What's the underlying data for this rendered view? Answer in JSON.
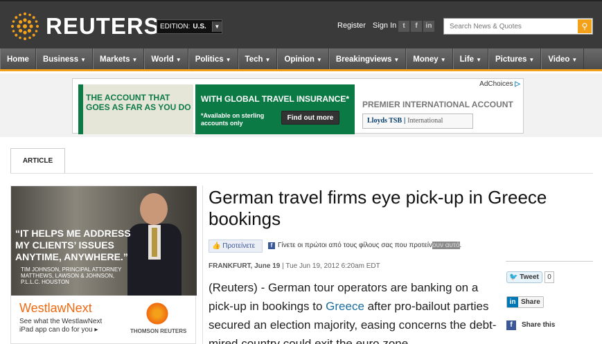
{
  "header": {
    "logo_text": "REUTERS",
    "edition_label": "EDITION:",
    "edition_value": "U.S.",
    "register": "Register",
    "signin": "Sign In",
    "search_placeholder": "Search News & Quotes",
    "accent_color": "#f4a11a"
  },
  "nav": {
    "items": [
      "Home",
      "Business",
      "Markets",
      "World",
      "Politics",
      "Tech",
      "Opinion",
      "Breakingviews",
      "Money",
      "Life",
      "Pictures",
      "Video"
    ]
  },
  "ad_banner": {
    "left_text": "THE ACCOUNT THAT GOES AS FAR AS YOU DO",
    "mid_heading": "WITH GLOBAL TRAVEL INSURANCE*",
    "mid_sub": "*Available on sterling accounts only",
    "mid_button": "Find out more",
    "right_heading": "PREMIER INTERNATIONAL ACCOUNT",
    "bank_name": "Lloyds TSB",
    "bank_sub": "International",
    "adchoices": "AdChoices"
  },
  "tab": {
    "label": "ARTICLE"
  },
  "side_ad": {
    "quote": "“IT HELPS ME ADDRESS MY CLIENTS’ ISSUES ANYTIME, ANYWHERE.”",
    "attribution": "TIM JOHNSON, PRINCIPAL ATTORNEY MATTHEWS, LAWSON & JOHNSON, P.L.L.C. HOUSTON",
    "brand": "WestlawNext",
    "sub": "See what the WestlawNext iPad app can do for you ▸",
    "tr_name": "THOMSON REUTERS"
  },
  "article": {
    "title": "German travel firms eye pick-up in Greece bookings",
    "recommend_button": "Προτείνετε",
    "recommend_text_pre": "Γίνετε οι πρώτοι από τους φίλους σας που προτείν",
    "recommend_text_hl": "ουν αυτό",
    "recommend_text_post": ".",
    "date_city": "FRANKFURT, June 19",
    "date_full": "| Tue Jun 19, 2012 6:20am EDT",
    "body_pre": "(Reuters) - German tour operators are banking on a pick-up in bookings to ",
    "body_link": "Greece",
    "body_post": " after pro-bailout parties secured an election majority, easing concerns the debt-mired country could exit the euro zone."
  },
  "share": {
    "tweet": "Tweet",
    "tweet_count": "0",
    "linkedin": "Share",
    "facebook": "Share this"
  }
}
